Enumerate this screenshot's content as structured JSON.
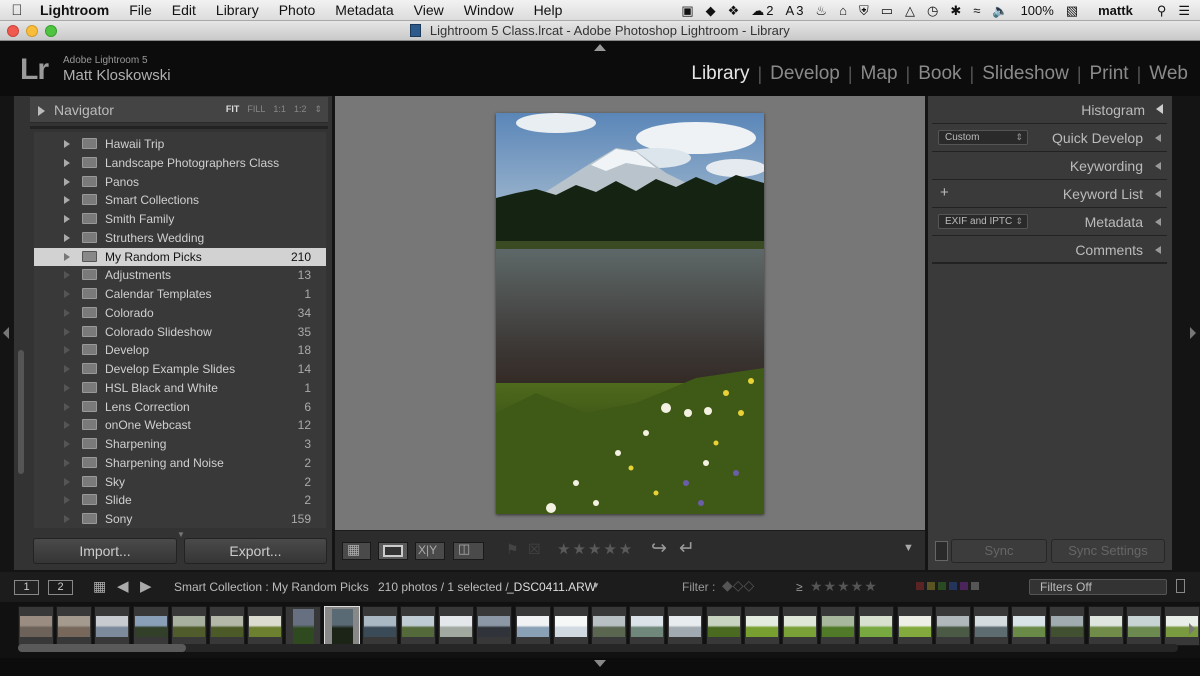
{
  "menubar": {
    "app": "Lightroom",
    "items": [
      "File",
      "Edit",
      "Library",
      "Photo",
      "Metadata",
      "View",
      "Window",
      "Help"
    ],
    "status": {
      "badge_2": "2",
      "badge_3": "3",
      "battery": "100%",
      "user": "mattk"
    }
  },
  "window": {
    "title": "Lightroom 5 Class.lrcat - Adobe Photoshop Lightroom - Library"
  },
  "identity": {
    "logo": "Lr",
    "app_name": "Adobe Lightroom 5",
    "user_name": "Matt Kloskowski"
  },
  "modules": [
    "Library",
    "Develop",
    "Map",
    "Book",
    "Slideshow",
    "Print",
    "Web"
  ],
  "active_module": "Library",
  "navigator": {
    "title": "Navigator",
    "zoom": [
      "FIT",
      "FILL",
      "1:1",
      "1:2"
    ]
  },
  "collections": [
    {
      "name": "Hawaii Trip",
      "count": "",
      "set": true
    },
    {
      "name": "Landscape Photographers Class",
      "count": "",
      "set": true
    },
    {
      "name": "Panos",
      "count": "",
      "set": true
    },
    {
      "name": "Smart Collections",
      "count": "",
      "set": true
    },
    {
      "name": "Smith Family",
      "count": "",
      "set": true
    },
    {
      "name": "Struthers Wedding",
      "count": "",
      "set": true
    },
    {
      "name": "My Random Picks",
      "count": "210",
      "set": false,
      "selected": true
    },
    {
      "name": "Adjustments",
      "count": "13",
      "set": false
    },
    {
      "name": "Calendar Templates",
      "count": "1",
      "set": false
    },
    {
      "name": "Colorado",
      "count": "34",
      "set": false
    },
    {
      "name": "Colorado Slideshow",
      "count": "35",
      "set": false
    },
    {
      "name": "Develop",
      "count": "18",
      "set": false
    },
    {
      "name": "Develop Example Slides",
      "count": "14",
      "set": false
    },
    {
      "name": "HSL Black and White",
      "count": "1",
      "set": false
    },
    {
      "name": "Lens Correction",
      "count": "6",
      "set": false
    },
    {
      "name": "onOne Webcast",
      "count": "12",
      "set": false
    },
    {
      "name": "Sharpening",
      "count": "3",
      "set": false
    },
    {
      "name": "Sharpening and Noise",
      "count": "2",
      "set": false
    },
    {
      "name": "Sky",
      "count": "2",
      "set": false
    },
    {
      "name": "Slide",
      "count": "2",
      "set": false
    },
    {
      "name": "Sony",
      "count": "159",
      "set": false
    }
  ],
  "left_buttons": {
    "import": "Import...",
    "export": "Export..."
  },
  "right_panels": {
    "histogram": "Histogram",
    "quick_develop": "Quick Develop",
    "quick_develop_preset": "Custom",
    "keywording": "Keywording",
    "keyword_list": "Keyword List",
    "metadata": "Metadata",
    "metadata_preset": "EXIF and IPTC",
    "comments": "Comments"
  },
  "sync": {
    "sync": "Sync",
    "sync_settings": "Sync Settings"
  },
  "filmstrip_bar": {
    "page1": "1",
    "page2": "2",
    "source": "Smart Collection : My Random Picks",
    "count_text": "210 photos / 1 selected /",
    "filename": "_DSC0411.ARW",
    "filter_label": "Filter :",
    "rating_op": "≥",
    "filters_off": "Filters Off"
  }
}
